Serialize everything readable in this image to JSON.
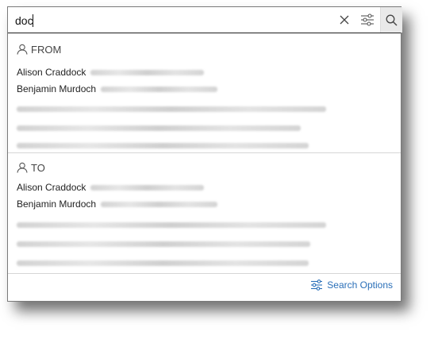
{
  "search": {
    "value": "doc",
    "placeholder": ""
  },
  "icons": {
    "clear": "close-icon",
    "filter": "filter-sliders-icon",
    "search": "search-icon",
    "person": "person-icon"
  },
  "sections": {
    "from": {
      "label": "FROM",
      "people": [
        {
          "name": "Alison Craddock"
        },
        {
          "name": "Benjamin Murdoch"
        }
      ]
    },
    "to": {
      "label": "TO",
      "people": [
        {
          "name": "Alison Craddock"
        },
        {
          "name": "Benjamin Murdoch"
        }
      ]
    }
  },
  "footer": {
    "search_options_label": "Search Options"
  },
  "colors": {
    "accent": "#2a6fb8",
    "border": "#1f1f1f",
    "search_button_bg": "#e9e9e9"
  }
}
